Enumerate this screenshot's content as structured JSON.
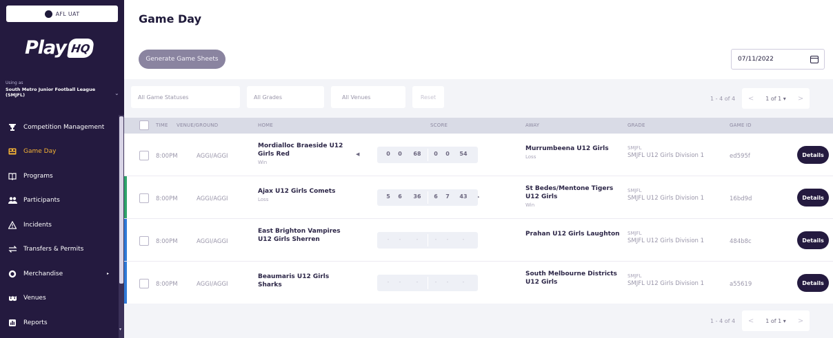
{
  "env": {
    "label": "AFL UAT"
  },
  "logo": {
    "play": "Play",
    "hq": "HQ"
  },
  "using_as": {
    "label": "Using as",
    "org": "South Metro Junior Football League (SMJFL)"
  },
  "nav": [
    {
      "label": "Competition Management",
      "icon": "trophy-icon"
    },
    {
      "label": "Game Day",
      "icon": "game-day-icon",
      "active": true
    },
    {
      "label": "Programs",
      "icon": "book-icon"
    },
    {
      "label": "Participants",
      "icon": "people-icon"
    },
    {
      "label": "Incidents",
      "icon": "warning-icon"
    },
    {
      "label": "Transfers & Permits",
      "icon": "transfer-icon"
    },
    {
      "label": "Merchandise",
      "icon": "merch-icon"
    },
    {
      "label": "Venues",
      "icon": "venue-icon"
    },
    {
      "label": "Reports",
      "icon": "reports-icon"
    }
  ],
  "page": {
    "title": "Game Day",
    "generate_label": "Generate Game Sheets",
    "date": "07/11/2022"
  },
  "filters": {
    "statuses": "All Game Statuses",
    "grades": "All Grades",
    "venues": "All Venues",
    "reset": "Reset"
  },
  "pager": {
    "range": "1 - 4 of 4",
    "page": "1 of 1",
    "prev": "<",
    "next": ">"
  },
  "table": {
    "headers": {
      "time": "TIME",
      "venue": "VENUE/GROUND",
      "home": "HOME",
      "score": "SCORE",
      "away": "AWAY",
      "grade": "GRADE",
      "gameid": "GAME ID"
    },
    "details_label": "Details",
    "rows": [
      {
        "time": "8:00PM",
        "venue": "AGGI/AGGI",
        "home": "Mordialloc Braeside U12 Girls Red",
        "home_result": "Win",
        "scores": [
          "0",
          "0",
          "68",
          "0",
          "0",
          "54"
        ],
        "winner_arrow": "◀",
        "away": "Murrumbeena U12 Girls",
        "away_result": "Loss",
        "grade_org": "SMJFL",
        "grade": "SMJFL U12 Girls Division 1",
        "game_id": "ed595f",
        "accent": "#ffffff"
      },
      {
        "time": "8:00PM",
        "venue": "AGGI/AGGI",
        "home": "Ajax U12 Girls Comets",
        "home_result": "Loss",
        "scores": [
          "5",
          "6",
          "36",
          "6",
          "7",
          "43"
        ],
        "winner_arrow": "▶",
        "away": "St Bedes/Mentone Tigers U12 Girls",
        "away_result": "Win",
        "grade_org": "SMJFL",
        "grade": "SMJFL U12 Girls Division 1",
        "game_id": "16bd9d",
        "accent": "#2fa46a"
      },
      {
        "time": "8:00PM",
        "venue": "AGGI/AGGI",
        "home": "East Brighton Vampires U12 Girls Sherren",
        "home_result": "",
        "scores": [
          "-",
          "-",
          "-",
          "-",
          "-",
          "-"
        ],
        "winner_arrow": "",
        "away": "Prahan U12 Girls Laughton",
        "away_result": "",
        "grade_org": "SMJFL",
        "grade": "SMJFL U12 Girls Division 1",
        "game_id": "484b8c",
        "accent": "#2f7ad8"
      },
      {
        "time": "8:00PM",
        "venue": "AGGI/AGGI",
        "home": "Beaumaris U12 Girls Sharks",
        "home_result": "",
        "scores": [
          "-",
          "-",
          "-",
          "-",
          "-",
          "-"
        ],
        "winner_arrow": "",
        "away": "South Melbourne Districts U12 Girls",
        "away_result": "",
        "grade_org": "SMJFL",
        "grade": "SMJFL U12 Girls Division 1",
        "game_id": "a55619",
        "accent": "#2f7ad8"
      }
    ]
  }
}
